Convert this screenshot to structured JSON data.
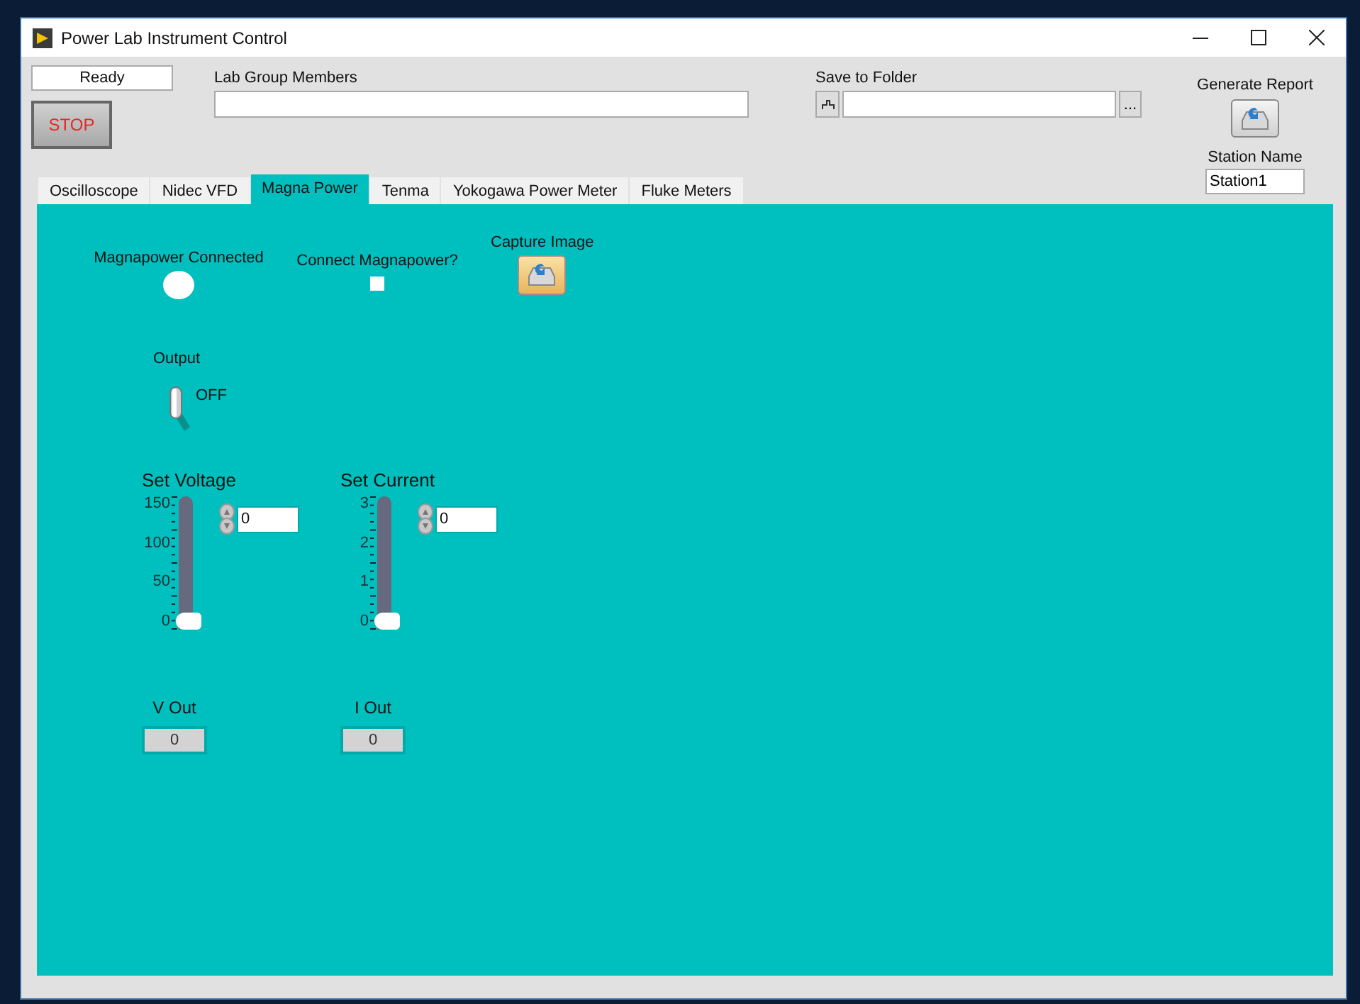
{
  "window": {
    "title": "Power Lab Instrument Control"
  },
  "header": {
    "status": "Ready",
    "stop_button": "STOP",
    "lab_group_members": {
      "label": "Lab Group Members"
    },
    "save_to_folder": {
      "label": "Save to Folder",
      "browse_button": "..."
    },
    "generate_report": {
      "label": "Generate Report"
    },
    "station_name": {
      "label": "Station Name",
      "value": "Station1"
    }
  },
  "tabs": [
    {
      "label": "Oscilloscope",
      "selected": false
    },
    {
      "label": "Nidec VFD",
      "selected": false
    },
    {
      "label": "Magna Power",
      "selected": true
    },
    {
      "label": "Tenma",
      "selected": false
    },
    {
      "label": "Yokogawa Power Meter",
      "selected": false
    },
    {
      "label": "Fluke Meters",
      "selected": false
    }
  ],
  "panel": {
    "connected_indicator": {
      "label": "Magnapower Connected",
      "on": false
    },
    "connect_checkbox": {
      "label": "Connect Magnapower?",
      "checked": false
    },
    "capture_image": {
      "label": "Capture Image"
    },
    "output_switch": {
      "label": "Output",
      "state_text": "OFF",
      "on": false
    },
    "sliders": [
      {
        "label": "Set Voltage",
        "ticks": [
          "150",
          "100",
          "50",
          "0"
        ],
        "level": 0,
        "value": "0"
      },
      {
        "label": "Set Current",
        "ticks": [
          "3",
          "2",
          "1",
          "0"
        ],
        "level": 0,
        "value": "0"
      }
    ],
    "readouts": [
      {
        "label": "V Out",
        "value": "0"
      },
      {
        "label": "I Out",
        "value": "0"
      }
    ]
  }
}
